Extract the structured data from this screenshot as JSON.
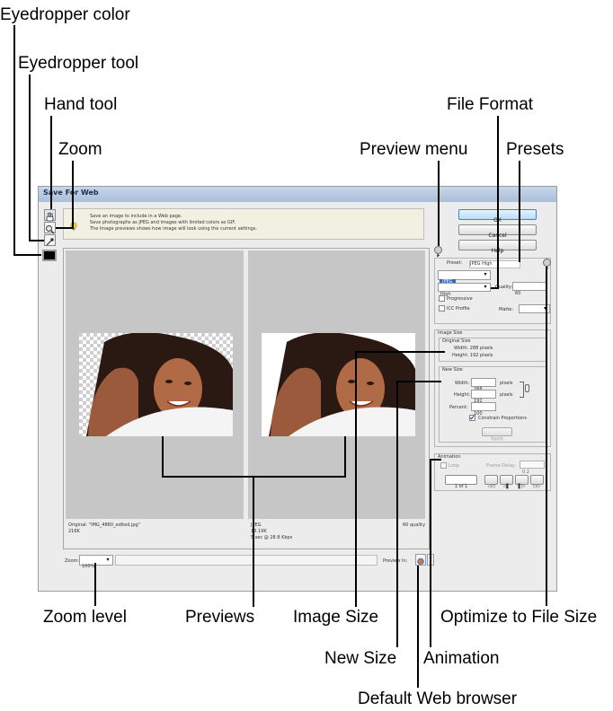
{
  "callouts": {
    "eyedropper_color": "Eyedropper color",
    "eyedropper_tool": "Eyedropper tool",
    "hand_tool": "Hand tool",
    "zoom": "Zoom",
    "file_format": "File Format",
    "preview_menu": "Preview menu",
    "presets": "Presets",
    "zoom_level": "Zoom level",
    "previews": "Previews",
    "image_size": "Image Size",
    "optimize_to_file_size": "Optimize to File Size",
    "new_size": "New Size",
    "animation": "Animation",
    "default_web_browser": "Default Web browser"
  },
  "dialog": {
    "title": "Save For Web",
    "info_lines": [
      "Save an image to include in a Web page.",
      "Save photographs as JPEG and images with limited colors as GIF.",
      "The Image previews shows how image will look using the current settings."
    ],
    "buttons": {
      "ok": "OK",
      "cancel": "Cancel",
      "help": "Help"
    },
    "preset": {
      "label": "Preset:",
      "value": "JPEG High"
    },
    "format_value": "JPEG",
    "quality_level": "High",
    "quality_label": "Quality:",
    "quality_value": "60",
    "progressive_label": "Progressive",
    "icc_label": "ICC Profile",
    "matte_label": "Matte:",
    "image_size": {
      "group_label": "Image Size",
      "original_label": "Original Size",
      "width_text": "Width: 288 pixels",
      "height_text": "Height: 192 pixels",
      "new_size_label": "New Size",
      "width_label": "Width:",
      "width_value": "288",
      "height_label": "Height:",
      "height_value": "192",
      "unit": "pixels",
      "percent_label": "Percent:",
      "percent_value": "100",
      "constrain_label": "Constrain Proportions",
      "apply_label": "Apply"
    },
    "animation": {
      "group_label": "Animation",
      "loop_label": "Loop",
      "frame_delay_label": "Frame Delay:",
      "frame_delay_value": "0.2",
      "frame_counter": "1 of 1",
      "nav_first": "◁◁",
      "nav_prev": "◁▌",
      "nav_next": "▌▷",
      "nav_last": "▷▷"
    },
    "left_pane": {
      "line1": "Original: \"IMG_4860_edited.jpg\"",
      "line2": "216K"
    },
    "right_pane": {
      "line1": "JPEG",
      "line2": "13.19K",
      "line3": "5 sec @ 28.8 Kbps",
      "quality": "60 quality"
    },
    "zoom": {
      "label": "Zoom:",
      "value": "100%"
    },
    "preview_in_label": "Preview In:"
  }
}
